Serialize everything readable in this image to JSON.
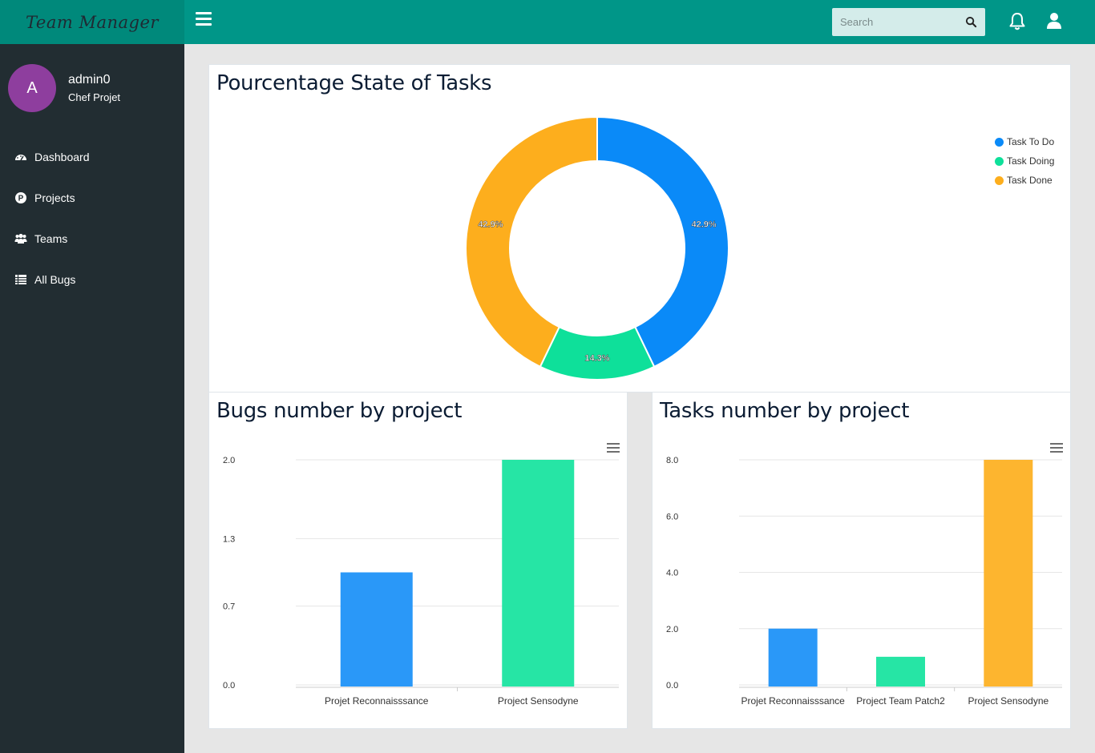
{
  "app": {
    "brand": "Team Manager"
  },
  "search": {
    "placeholder": "Search"
  },
  "user": {
    "initial": "A",
    "name": "admin0",
    "role": "Chef Projet"
  },
  "sidebar": {
    "items": [
      {
        "label": "Dashboard",
        "icon": "dashboard-icon"
      },
      {
        "label": "Projects",
        "icon": "projects-icon"
      },
      {
        "label": "Teams",
        "icon": "users-icon"
      },
      {
        "label": "All Bugs",
        "icon": "list-icon"
      }
    ]
  },
  "colors": {
    "topbar": "#009688",
    "sidebar": "#222d32",
    "blue": "#1b8ef8",
    "green": "#19e29e",
    "orange": "#fdae1d"
  },
  "charts": {
    "tasks_state": {
      "title": "Pourcentage State of Tasks",
      "chart_data": {
        "type": "pie",
        "donut": true,
        "labels": [
          "Task To Do",
          "Task Doing",
          "Task Done"
        ],
        "values": [
          42.9,
          14.3,
          42.9
        ],
        "value_labels": [
          "42.9%",
          "14.3%",
          "42.9%"
        ],
        "colors": [
          "#0a8af8",
          "#0ee09a",
          "#fdae1d"
        ],
        "legend": "top-right"
      }
    },
    "bugs_by_project": {
      "title": "Bugs number by project",
      "chart_data": {
        "type": "bar",
        "categories": [
          "Projet Reconnaisssance",
          "Project Sensodyne"
        ],
        "values": [
          1,
          2
        ],
        "ylim": [
          0,
          2
        ],
        "yticks": [
          "0.0",
          "0.7",
          "1.3",
          "2.0"
        ],
        "colors": [
          "#2a98f8",
          "#26e5a5"
        ],
        "grid": true
      }
    },
    "tasks_by_project": {
      "title": "Tasks number by project",
      "chart_data": {
        "type": "bar",
        "categories": [
          "Projet Reconnaisssance",
          "Project Team Patch2",
          "Project Sensodyne"
        ],
        "values": [
          2,
          1,
          8
        ],
        "ylim": [
          0,
          8
        ],
        "yticks": [
          "0.0",
          "2.0",
          "4.0",
          "6.0",
          "8.0"
        ],
        "colors": [
          "#2a98f8",
          "#26e5a5",
          "#fdb52f"
        ],
        "grid": true
      }
    }
  }
}
